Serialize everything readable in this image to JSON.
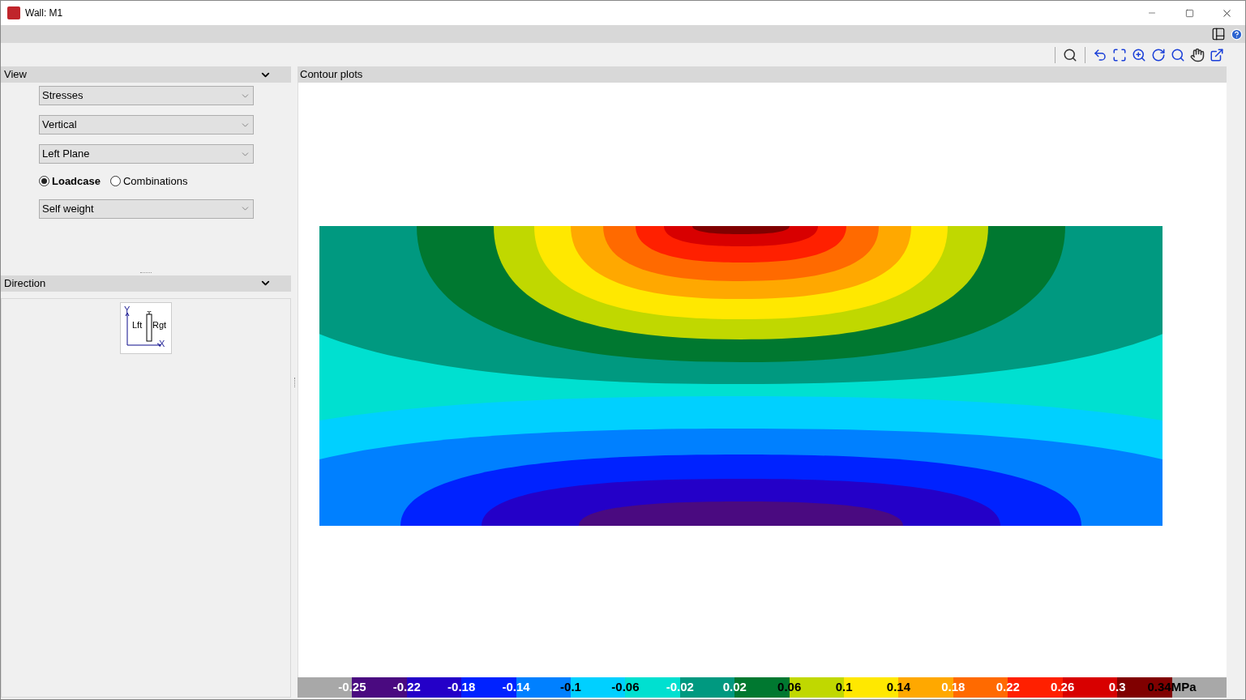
{
  "window": {
    "title": "Wall: M1"
  },
  "view_panel": {
    "title": "View",
    "dropdowns": [
      "Stresses",
      "Vertical",
      "Left Plane"
    ],
    "source_options": [
      {
        "label": "Loadcase",
        "selected": true
      },
      {
        "label": "Combinations",
        "selected": false
      }
    ],
    "case_dropdown": "Self weight"
  },
  "direction_panel": {
    "title": "Direction",
    "diagram": {
      "y_axis": "Y",
      "left": "Lft",
      "right": "Rgt",
      "x_axis": "X"
    }
  },
  "plot_panel": {
    "title": "Contour plots",
    "legend_labels": [
      "-0.25",
      "-0.22",
      "-0.18",
      "-0.14",
      "-0.1",
      "-0.06",
      "-0.02",
      "0.02",
      "0.06",
      "0.1",
      "0.14",
      "0.18",
      "0.22",
      "0.26",
      "0.3",
      "0.34MPa"
    ],
    "legend_bands": [
      {
        "color": "#4a0a80"
      },
      {
        "color": "#2400c8"
      },
      {
        "color": "#0022ff"
      },
      {
        "color": "#0080ff"
      },
      {
        "color": "#00d0ff"
      },
      {
        "color": "#00e0d0"
      },
      {
        "color": "#009980"
      },
      {
        "color": "#007830"
      },
      {
        "color": "#c0d800"
      },
      {
        "color": "#ffe800"
      },
      {
        "color": "#ffa800"
      },
      {
        "color": "#ff6a00"
      },
      {
        "color": "#ff2000"
      },
      {
        "color": "#d80000"
      },
      {
        "color": "#800000"
      }
    ]
  }
}
